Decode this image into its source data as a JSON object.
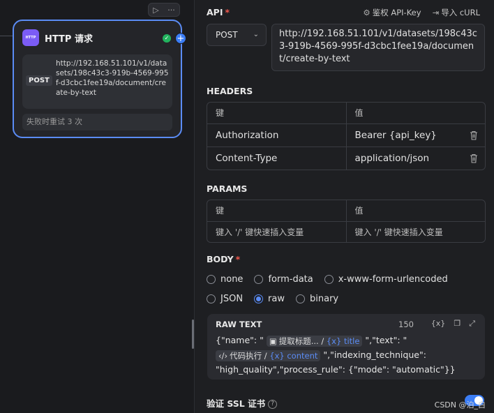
{
  "node": {
    "icon_label": "HTTP",
    "title": "HTTP 请求",
    "method": "POST",
    "url": "http://192.168.51.101/v1/datasets/198c43c3-919b-4569-995f-d3cbc1fee19a/document/create-by-text",
    "retry": "失败时重试 3 次",
    "toolbar_run": "▷",
    "toolbar_more": "···"
  },
  "panel": {
    "api_title": "API",
    "auth_label": "鉴权 API-Key",
    "curl_label": "导入 cURL",
    "method": "POST",
    "url": "http://192.168.51.101/v1/datasets/198c43c3-919b-4569-995f-d3cbc1fee19a/document/create-by-text",
    "headers_title": "HEADERS",
    "params_title": "PARAMS",
    "key_header": "键",
    "value_header": "值",
    "headers": [
      {
        "key": "Authorization",
        "value": "Bearer {api_key}"
      },
      {
        "key": "Content-Type",
        "value": "application/json"
      }
    ],
    "param_key_placeholder": "键入 '/' 键快速插入变量",
    "param_value_placeholder": "键入 '/' 键快速插入变量",
    "body_title": "BODY",
    "body_options_row1": [
      "none",
      "form-data",
      "x-www-form-urlencoded"
    ],
    "body_options_row2": [
      "JSON",
      "raw",
      "binary"
    ],
    "body_selected": "raw",
    "raw": {
      "title": "RAW TEXT",
      "count": "150",
      "text_1": "{\"name\": \"",
      "chip1_node": "提取标题...",
      "chip1_var": "{x} title",
      "text_2": "\",\"text\": \"",
      "chip2_node": "代码执行",
      "chip2_var": "{x} content",
      "text_3": "\",\"indexing_technique\":",
      "text_4": "\"high_quality\",\"process_rule\": {\"mode\": \"automatic\"}}"
    },
    "ssl_label": "验证 SSL 证书",
    "watermark": "CSDN @泊_白"
  },
  "colors": {
    "accent": "#5b8cf5",
    "required": "#f0574c",
    "node_icon": "#7b5cf5",
    "success": "#22b35e"
  }
}
